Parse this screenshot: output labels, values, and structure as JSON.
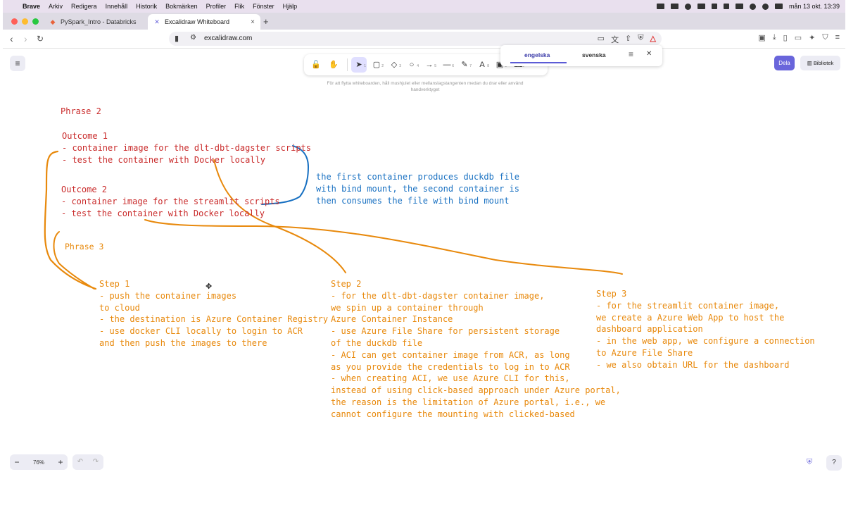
{
  "menubar": {
    "app": "Brave",
    "items": [
      "Arkiv",
      "Redigera",
      "Innehåll",
      "Historik",
      "Bokmärken",
      "Profiler",
      "Flik",
      "Fönster",
      "Hjälp"
    ],
    "clock": "mån 13 okt. 13:39"
  },
  "tabs": [
    {
      "title": "PySpark_Intro - Databricks",
      "icon": "databricks-icon"
    },
    {
      "title": "Excalidraw Whiteboard",
      "icon": "excalidraw-icon"
    }
  ],
  "address": {
    "url": "excalidraw.com"
  },
  "translate_panel": {
    "lang_a": "engelska",
    "lang_b": "svenska"
  },
  "toolbar": {
    "tools": [
      {
        "icon": "lock-icon",
        "glyph": "🔓",
        "num": ""
      },
      {
        "icon": "hand-icon",
        "glyph": "✋",
        "num": ""
      },
      {
        "icon": "selection-icon",
        "glyph": "➤",
        "num": "1"
      },
      {
        "icon": "rectangle-icon",
        "glyph": "▢",
        "num": "2"
      },
      {
        "icon": "diamond-icon",
        "glyph": "◇",
        "num": "3"
      },
      {
        "icon": "ellipse-icon",
        "glyph": "○",
        "num": "4"
      },
      {
        "icon": "arrow-icon",
        "glyph": "→",
        "num": "5"
      },
      {
        "icon": "line-icon",
        "glyph": "—",
        "num": "6"
      },
      {
        "icon": "pencil-icon",
        "glyph": "✎",
        "num": "7"
      },
      {
        "icon": "text-icon",
        "glyph": "A",
        "num": "8"
      },
      {
        "icon": "image-icon",
        "glyph": "▣",
        "num": "9"
      },
      {
        "icon": "eraser-icon",
        "glyph": "⌫",
        "num": "0"
      }
    ],
    "hint": "För att flytta whiteboarden, håll mushjulet eller mellanslagstangenten medan du drar eller använd handverktyget"
  },
  "buttons": {
    "share": "Dela",
    "library": "Bibliotek"
  },
  "zoom": {
    "minus": "−",
    "value": "76%",
    "plus": "+"
  },
  "canvas_text": {
    "phrase2": "Phrase 2",
    "outcome1": "Outcome 1",
    "o1_line1": "- container image for the dlt-dbt-dagster scripts",
    "o1_line2": "- test the container with Docker locally",
    "note_line1": "the first container produces duckdb file",
    "note_line2": "with bind mount, the second container is",
    "note_line3": "then consumes the file with bind mount",
    "outcome2": "Outcome 2",
    "o2_line1": "- container image for the streamlit scripts",
    "o2_line2": "- test the container with Docker locally",
    "phrase3": "Phrase 3",
    "step1": "Step 1\n- push the container images\nto cloud\n- the destination is Azure Container Registry\n- use docker CLI locally to login to ACR\nand then push the images to there",
    "step2": "Step 2\n- for the dlt-dbt-dagster container image,\nwe spin up a container through\nAzure Container Instance\n- use Azure File Share for persistent storage\nof the duckdb file\n- ACI can get container image from ACR, as long\nas you provide the credentials to log in to ACR\n- when creating ACI, we use Azure CLI for this,\ninstead of using click-based approach under Azure portal,\nthe reason is the limitation of Azure portal, i.e., we\ncannot configure the mounting with clicked-based",
    "step3": "Step 3\n- for the streamlit container image,\nwe create a Azure Web App to host the\ndashboard application\n- in the web app, we configure a connection\nto Azure File Share\n- we also obtain URL for the dashboard"
  },
  "colors": {
    "red": "#c92a2a",
    "blue": "#1971c2",
    "orange": "#e8890c",
    "accent": "#6965db"
  }
}
